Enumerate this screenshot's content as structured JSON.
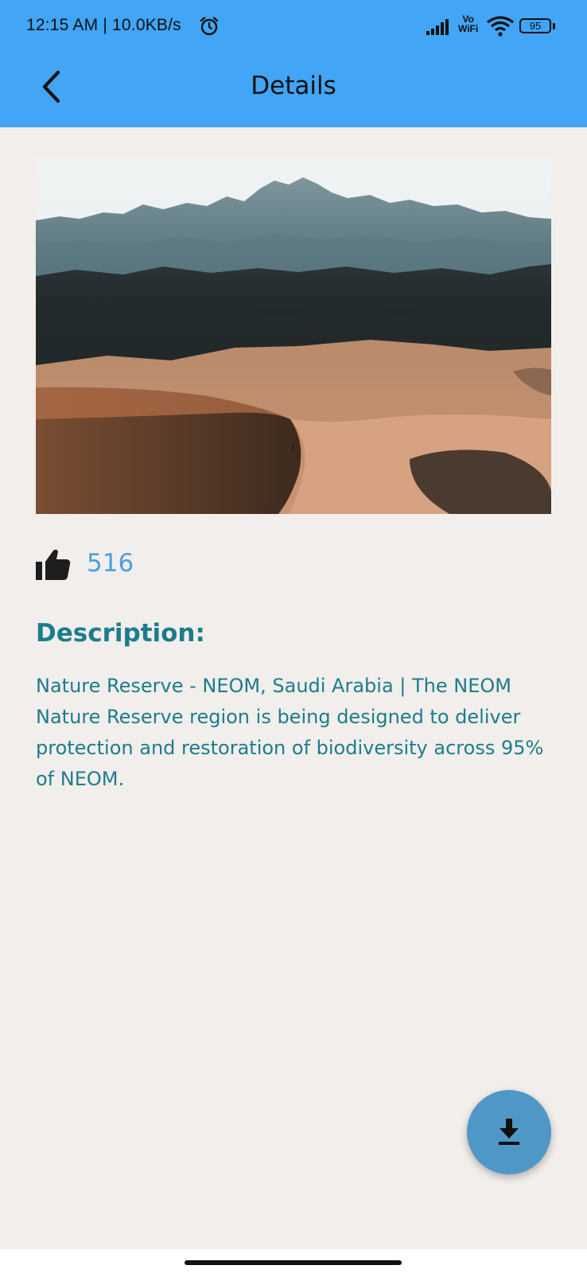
{
  "status_bar": {
    "time": "12:15 AM | 10.0KB/s",
    "vowifi_top": "Vo",
    "vowifi_bottom": "WiFi",
    "battery": "95",
    "icons": [
      "alarm-icon",
      "signal-icon",
      "wifi-icon",
      "battery-icon"
    ]
  },
  "header": {
    "title": "Details",
    "back_icon": "chevron-left-icon"
  },
  "content": {
    "image_subject": "desert-mountain-landscape",
    "like_icon": "thumbs-up-icon",
    "likes": "516",
    "description_heading": "Description:",
    "description": "Nature Reserve - NEOM, Saudi Arabia | The NEOM Nature Reserve region is being designed to deliver protection and restoration of biodiversity across 95% of NEOM."
  },
  "fab": {
    "icon": "download-icon"
  },
  "colors": {
    "app_bar": "#42a5f5",
    "background": "#f2eeeb",
    "accent_text": "#1b7d8c",
    "likes_text": "#4a9fe0",
    "fab": "#4f97c7"
  }
}
